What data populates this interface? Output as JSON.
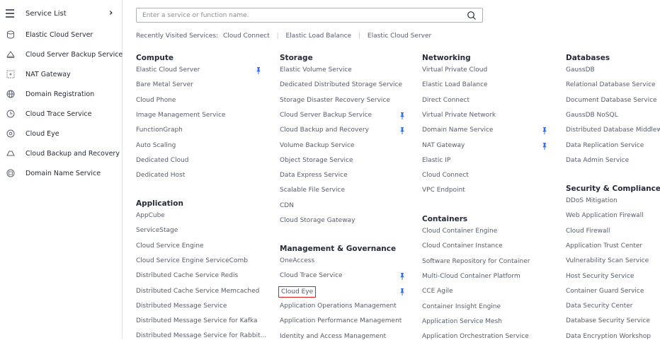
{
  "sidebar": {
    "title": "Service List",
    "items": [
      {
        "label": "Elastic Cloud Server",
        "icon": "server-icon"
      },
      {
        "label": "Cloud Server Backup Service",
        "icon": "backup-icon"
      },
      {
        "label": "NAT Gateway",
        "icon": "gateway-icon"
      },
      {
        "label": "Domain Registration",
        "icon": "globe-icon"
      },
      {
        "label": "Cloud Trace Service",
        "icon": "trace-icon"
      },
      {
        "label": "Cloud Eye",
        "icon": "eye-icon"
      },
      {
        "label": "Cloud Backup and Recovery",
        "icon": "cloud-icon"
      },
      {
        "label": "Domain Name Service",
        "icon": "dns-icon"
      }
    ]
  },
  "search": {
    "placeholder": "Enter a service or function name."
  },
  "recent": {
    "label": "Recently Visited Services:",
    "items": [
      "Cloud Connect",
      "Elastic Load Balance",
      "Elastic Cloud Server"
    ]
  },
  "categories": {
    "compute": {
      "title": "Compute",
      "items": [
        "Elastic Cloud Server",
        "Bare Metal Server",
        "Cloud Phone",
        "Image Management Service",
        "FunctionGraph",
        "Auto Scaling",
        "Dedicated Cloud",
        "Dedicated Host"
      ]
    },
    "application": {
      "title": "Application",
      "items": [
        "AppCube",
        "ServiceStage",
        "Cloud Service Engine",
        "Cloud Service Engine ServiceComb",
        "Distributed Cache Service Redis",
        "Distributed Cache Service Memcached",
        "Distributed Message Service",
        "Distributed Message Service for Kafka",
        "Distributed Message Service for Rabbit..."
      ]
    },
    "storage": {
      "title": "Storage",
      "items": [
        "Elastic Volume Service",
        "Dedicated Distributed Storage Service",
        "Storage Disaster Recovery Service",
        "Cloud Server Backup Service",
        "Cloud Backup and Recovery",
        "Volume Backup Service",
        "Object Storage Service",
        "Data Express Service",
        "Scalable File Service",
        "CDN",
        "Cloud Storage Gateway"
      ]
    },
    "management": {
      "title": "Management & Governance",
      "items": [
        "OneAccess",
        "Cloud Trace Service",
        "Cloud Eye",
        "Application Operations Management",
        "Application Performance Management",
        "Identity and Access Management"
      ]
    },
    "networking": {
      "title": "Networking",
      "items": [
        "Virtual Private Cloud",
        "Elastic Load Balance",
        "Direct Connect",
        "Virtual Private Network",
        "Domain Name Service",
        "NAT Gateway",
        "Elastic IP",
        "Cloud Connect",
        "VPC Endpoint"
      ]
    },
    "containers": {
      "title": "Containers",
      "items": [
        "Cloud Container Engine",
        "Cloud Container Instance",
        "Software Repository for Container",
        "Multi-Cloud Container Platform",
        "CCE Agile",
        "Container Insight Engine",
        "Application Service Mesh",
        "Application Orchestration Service"
      ]
    },
    "databases": {
      "title": "Databases",
      "items": [
        "GaussDB",
        "Relational Database Service",
        "Document Database Service",
        "GaussDB NoSQL",
        "Distributed Database Middleware",
        "Data Replication Service",
        "Data Admin Service"
      ]
    },
    "security": {
      "title": "Security & Compliance",
      "items": [
        "DDoS Mitigation",
        "Web Application Firewall",
        "Cloud Firewall",
        "Application Trust Center",
        "Vulnerability Scan Service",
        "Host Security Service",
        "Container Guard Service",
        "Data Security Center",
        "Database Security Service",
        "Data Encryption Workshop"
      ]
    }
  },
  "colors": {
    "pin": "#2f6ee6",
    "highlight": "#e61b1b",
    "text": "#575d6c",
    "title": "#252b3a"
  }
}
